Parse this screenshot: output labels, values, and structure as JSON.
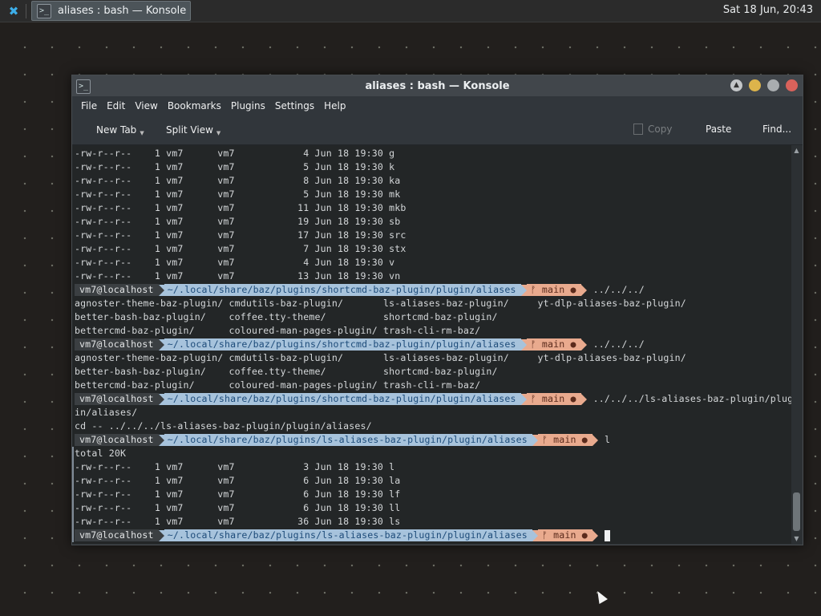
{
  "panel": {
    "task_title": "aliases : bash — Konsole",
    "clock": "Sat 18 Jun, 20:43"
  },
  "window": {
    "title": "aliases : bash — Konsole",
    "menu": [
      "File",
      "Edit",
      "View",
      "Bookmarks",
      "Plugins",
      "Settings",
      "Help"
    ],
    "toolbar": {
      "new_tab": "New Tab",
      "split_view": "Split View",
      "copy": "Copy",
      "paste": "Paste",
      "find": "Find..."
    }
  },
  "prompt": {
    "user": "vm7@localhost",
    "git": "ᚠ main ●"
  },
  "terminal": {
    "lines": [
      {
        "kind": "text",
        "text": "-rw-r--r--    1 vm7      vm7            4 Jun 18 19:30 g"
      },
      {
        "kind": "text",
        "text": "-rw-r--r--    1 vm7      vm7            5 Jun 18 19:30 k"
      },
      {
        "kind": "text",
        "text": "-rw-r--r--    1 vm7      vm7            8 Jun 18 19:30 ka"
      },
      {
        "kind": "text",
        "text": "-rw-r--r--    1 vm7      vm7            5 Jun 18 19:30 mk"
      },
      {
        "kind": "text",
        "text": "-rw-r--r--    1 vm7      vm7           11 Jun 18 19:30 mkb"
      },
      {
        "kind": "text",
        "text": "-rw-r--r--    1 vm7      vm7           19 Jun 18 19:30 sb"
      },
      {
        "kind": "text",
        "text": "-rw-r--r--    1 vm7      vm7           17 Jun 18 19:30 src"
      },
      {
        "kind": "text",
        "text": "-rw-r--r--    1 vm7      vm7            7 Jun 18 19:30 stx"
      },
      {
        "kind": "text",
        "text": "-rw-r--r--    1 vm7      vm7            4 Jun 18 19:30 v"
      },
      {
        "kind": "text",
        "text": "-rw-r--r--    1 vm7      vm7           13 Jun 18 19:30 vn"
      },
      {
        "kind": "prompt",
        "path": "~/.local/share/baz/plugins/shortcmd-baz-plugin/plugin/aliases",
        "cmd": "../../../"
      },
      {
        "kind": "text",
        "text": "agnoster-theme-baz-plugin/ cmdutils-baz-plugin/       ls-aliases-baz-plugin/     yt-dlp-aliases-baz-plugin/"
      },
      {
        "kind": "text",
        "text": "better-bash-baz-plugin/    coffee.tty-theme/          shortcmd-baz-plugin/"
      },
      {
        "kind": "text",
        "text": "bettercmd-baz-plugin/      coloured-man-pages-plugin/ trash-cli-rm-baz/"
      },
      {
        "kind": "prompt",
        "path": "~/.local/share/baz/plugins/shortcmd-baz-plugin/plugin/aliases",
        "cmd": "../../../"
      },
      {
        "kind": "text",
        "text": "agnoster-theme-baz-plugin/ cmdutils-baz-plugin/       ls-aliases-baz-plugin/     yt-dlp-aliases-baz-plugin/"
      },
      {
        "kind": "text",
        "text": "better-bash-baz-plugin/    coffee.tty-theme/          shortcmd-baz-plugin/"
      },
      {
        "kind": "text",
        "text": "bettercmd-baz-plugin/      coloured-man-pages-plugin/ trash-cli-rm-baz/"
      },
      {
        "kind": "prompt",
        "path": "~/.local/share/baz/plugins/shortcmd-baz-plugin/plugin/aliases",
        "cmd": "../../../ls-aliases-baz-plugin/plug"
      },
      {
        "kind": "text",
        "text": "in/aliases/"
      },
      {
        "kind": "text",
        "text": "cd -- ../../../ls-aliases-baz-plugin/plugin/aliases/"
      },
      {
        "kind": "prompt",
        "path": "~/.local/share/baz/plugins/ls-aliases-baz-plugin/plugin/aliases",
        "cmd": "l"
      },
      {
        "kind": "text",
        "text": "total 20K",
        "marked": true
      },
      {
        "kind": "text",
        "text": "-rw-r--r--    1 vm7      vm7            3 Jun 18 19:30 l",
        "marked": true
      },
      {
        "kind": "text",
        "text": "-rw-r--r--    1 vm7      vm7            6 Jun 18 19:30 la",
        "marked": true
      },
      {
        "kind": "text",
        "text": "-rw-r--r--    1 vm7      vm7            6 Jun 18 19:30 lf",
        "marked": true
      },
      {
        "kind": "text",
        "text": "-rw-r--r--    1 vm7      vm7            6 Jun 18 19:30 ll",
        "marked": true
      },
      {
        "kind": "text",
        "text": "-rw-r--r--    1 vm7      vm7           36 Jun 18 19:30 ls",
        "marked": true
      },
      {
        "kind": "prompt",
        "path": "~/.local/share/baz/plugins/ls-aliases-baz-plugin/plugin/aliases",
        "cmd": "",
        "cursor": true,
        "marked": true
      }
    ]
  }
}
